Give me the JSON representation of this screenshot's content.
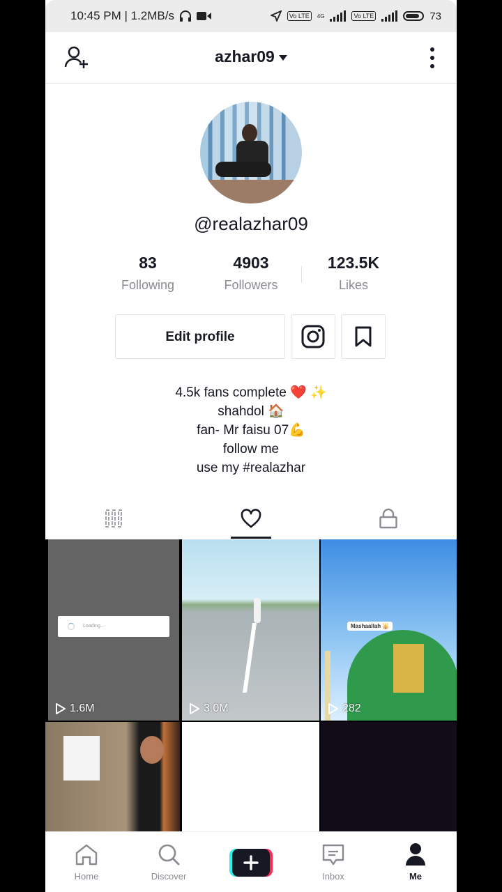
{
  "status_bar": {
    "time_speed": "10:45 PM | 1.2MB/s",
    "net_type": "4G",
    "volte": "Vo LTE",
    "battery": "73"
  },
  "header": {
    "title": "azhar09",
    "add_friend_icon": "person-add-icon",
    "more_icon": "more-vertical-icon"
  },
  "profile": {
    "handle": "@realazhar09",
    "stats": [
      {
        "value": "83",
        "label": "Following"
      },
      {
        "value": "4903",
        "label": "Followers"
      },
      {
        "value": "123.5K",
        "label": "Likes"
      }
    ],
    "edit_button": "Edit profile",
    "bio": [
      "4.5k fans complete ❤️ ✨",
      "shahdol 🏠",
      "fan- Mr faisu 07💪",
      "follow me",
      "use my #realazhar"
    ]
  },
  "tabs": [
    {
      "icon": "grid-icon",
      "active": false
    },
    {
      "icon": "heart-icon",
      "active": true
    },
    {
      "icon": "lock-icon",
      "active": false
    }
  ],
  "videos": [
    {
      "views": "1.6M",
      "overlay": "Loading..."
    },
    {
      "views": "3.0M"
    },
    {
      "views": "282",
      "overlay": "Mashaallah 🕌"
    },
    {
      "views": ""
    },
    {
      "views": ""
    },
    {
      "views": ""
    }
  ],
  "bottom_nav": [
    {
      "label": "Home",
      "icon": "home-icon"
    },
    {
      "label": "Discover",
      "icon": "search-icon"
    },
    {
      "label": "",
      "icon": "plus-icon"
    },
    {
      "label": "Inbox",
      "icon": "inbox-icon"
    },
    {
      "label": "Me",
      "icon": "profile-icon",
      "active": true
    }
  ],
  "colors": {
    "primary_text": "#161823",
    "secondary_text": "#8a8b91",
    "heart": "#fe2c55",
    "cyan": "#25f4ee"
  }
}
